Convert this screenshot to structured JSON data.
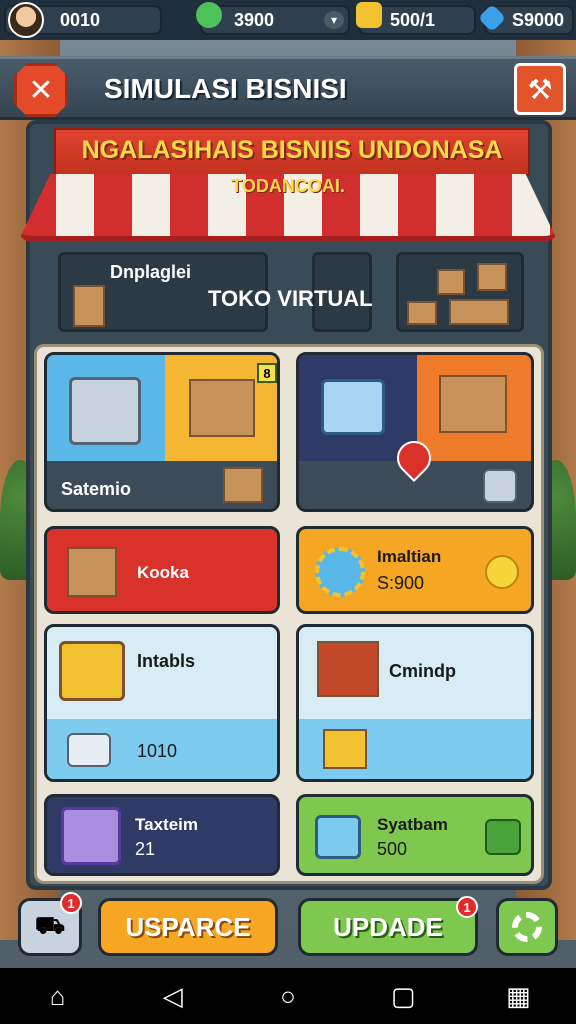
{
  "top_bar": {
    "player_value": "0010",
    "green_currency": "3900",
    "gold_currency": "500/1",
    "blue_currency": "S9000"
  },
  "header": {
    "title": "SIMULASI BISNISI",
    "close_icon": "close-icon",
    "tools_icon": "tools-icon"
  },
  "store": {
    "banner": "NGALASIHAIS BISNIIS UNDONASA",
    "subtitle": "TODANCOAI.",
    "left_label": "Dnplaglei",
    "right_label": "TOKO VIRTUAL"
  },
  "cards": {
    "card1_badge": "8",
    "card1_label": "Satemio",
    "card2_label": "",
    "card3_label": "Kooka",
    "card4_label": "Imaltian",
    "card4_value": "S:900",
    "card5_label": "Intabls",
    "card5_value": "1010",
    "card6_label": "Cmindp",
    "card7_label": "Taxteim",
    "card7_value": "21",
    "card8_label": "Syatbam",
    "card8_value": "500"
  },
  "buttons": {
    "truck_badge": "1",
    "usparce": "USPARCE",
    "update": "UPDADE",
    "update_badge": "1"
  },
  "colors": {
    "red": "#d8322a",
    "orange": "#f5a623",
    "green": "#7ec850",
    "blue": "#5ab7e8",
    "navy": "#2f3a66"
  }
}
